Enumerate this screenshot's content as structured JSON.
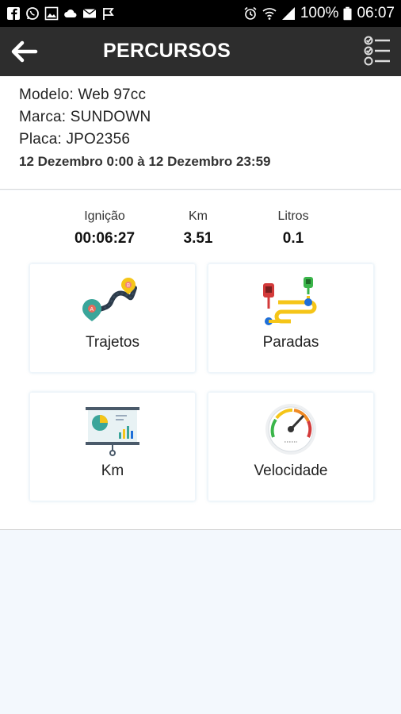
{
  "status_bar": {
    "battery_percent": "100%",
    "time": "06:07",
    "icons": [
      "facebook-icon",
      "whatsapp-icon",
      "image-icon",
      "cloud-icon",
      "mail-icon",
      "flag-icon",
      "alarm-icon",
      "wifi-icon",
      "signal-icon",
      "battery-icon"
    ]
  },
  "app_bar": {
    "title": "PERCURSOS",
    "background": "#2d2d2d"
  },
  "vehicle": {
    "modelo": "Modelo: Web 97cc",
    "marca": "Marca: SUNDOWN",
    "placa": "Placa: JPO2356",
    "period": "12 Dezembro 0:00 à 12 Dezembro 23:59"
  },
  "stats": [
    {
      "label": "Ignição",
      "value": "00:06:27"
    },
    {
      "label": "Km",
      "value": "3.51"
    },
    {
      "label": "Litros",
      "value": "0.1"
    }
  ],
  "tiles": [
    {
      "label": "Trajetos",
      "icon": "route-map-icon"
    },
    {
      "label": "Paradas",
      "icon": "stops-route-icon"
    },
    {
      "label": "Km",
      "icon": "presentation-chart-icon"
    },
    {
      "label": "Velocidade",
      "icon": "speedometer-icon"
    }
  ],
  "colors": {
    "background": "#f3f8fd",
    "accent_teal": "#3aa59a",
    "accent_yellow": "#f5c518",
    "accent_blue": "#1e6fd9",
    "accent_red": "#d33a3a"
  }
}
